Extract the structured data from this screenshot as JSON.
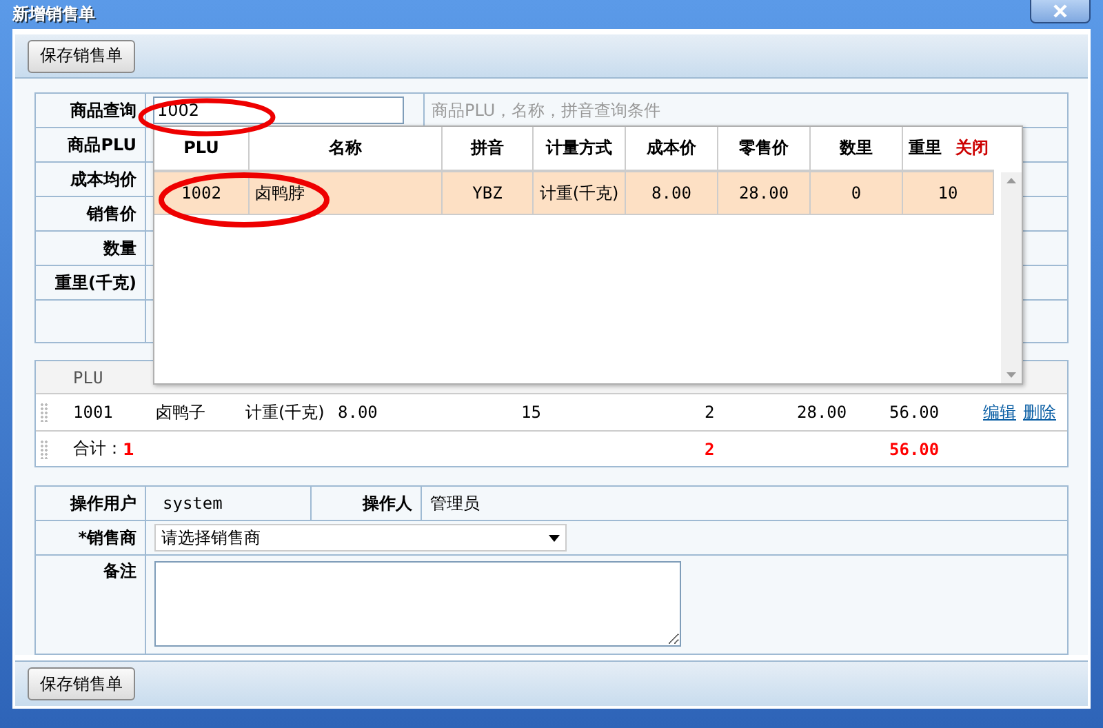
{
  "window": {
    "title": "新增销售单"
  },
  "top_toolbar": {
    "button": "保存销售单"
  },
  "search_form": {
    "query": {
      "label": "商品查询",
      "value": "1002",
      "hint": "商品PLU，名称，拼音查询条件",
      "circled": true
    },
    "fields": [
      {
        "label": "商品PLU"
      },
      {
        "label": "成本均价"
      },
      {
        "label": "销售价"
      },
      {
        "label": "数量"
      },
      {
        "label": "重里(千克)"
      }
    ]
  },
  "popup": {
    "columns": [
      "PLU",
      "名称",
      "拼音",
      "计量方式",
      "成本价",
      "零售价",
      "数里",
      "重里"
    ],
    "close": "关闭",
    "rows": [
      {
        "cells": [
          "1002",
          "卤鸭脖",
          "YBZ",
          "计重(千克)",
          "8.00",
          "28.00",
          "0",
          "10"
        ],
        "selected": true,
        "circled": true
      }
    ]
  },
  "grid": {
    "plu_header": "PLU",
    "rows": [
      {
        "plu": "1001",
        "column_3": "卤鸭子",
        "column_4": "计重(千克)",
        "column_5": "8.00",
        "column_7": "15",
        "column_9": "2",
        "column_10": "28.00",
        "column_11": "56.00",
        "actions": [
          "编辑",
          "删除"
        ]
      }
    ],
    "total": {
      "label": "合计：",
      "count": "1",
      "column_9": "2",
      "column_11": "56.00"
    }
  },
  "footer_form": {
    "operator_user": {
      "label": "操作用户",
      "value": "system"
    },
    "operator": {
      "label": "操作人",
      "value": "管理员"
    },
    "vendor": {
      "label": "*销售商",
      "placeholder": "请选择销售商"
    },
    "notes": {
      "label": "备注"
    }
  },
  "bottom_toolbar": {
    "button": "保存销售单"
  }
}
